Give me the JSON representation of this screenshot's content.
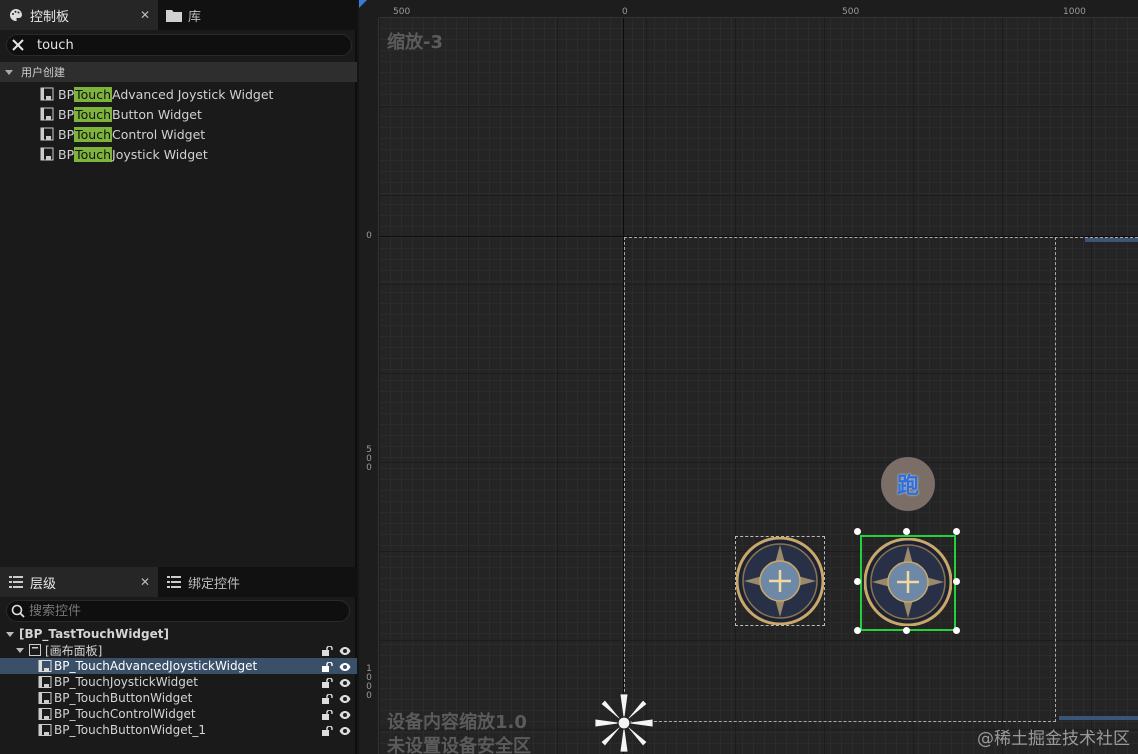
{
  "palette_panel": {
    "tab_palette": "控制板",
    "tab_library": "库",
    "close_glyph": "✕",
    "search_value": "touch",
    "category": "用户创建",
    "items": [
      {
        "prefix": "BP",
        "match": "Touch",
        "suffix": " Advanced Joystick Widget"
      },
      {
        "prefix": "BP",
        "match": "Touch",
        "suffix": " Button Widget"
      },
      {
        "prefix": "BP",
        "match": "Touch",
        "suffix": " Control Widget"
      },
      {
        "prefix": "BP",
        "match": "Touch",
        "suffix": " Joystick Widget"
      }
    ]
  },
  "hierarchy_panel": {
    "tab_hierarchy": "层级",
    "tab_bind": "绑定控件",
    "close_glyph": "✕",
    "search_placeholder": "搜索控件",
    "root": "[BP_TastTouchWidget]",
    "canvas": "[画布面板]",
    "children": [
      {
        "label": "BP_TouchAdvancedJoystickWidget",
        "selected": true
      },
      {
        "label": "BP_TouchJoystickWidget",
        "selected": false
      },
      {
        "label": "BP_TouchButtonWidget",
        "selected": false
      },
      {
        "label": "BP_TouchControlWidget",
        "selected": false
      },
      {
        "label": "BP_TouchButtonWidget_1",
        "selected": false
      }
    ]
  },
  "designer": {
    "zoom_label": "缩放-3",
    "ruler_top": [
      "500",
      "0",
      "500",
      "1000"
    ],
    "ruler_left_0": "0",
    "ruler_left_500": "5\n0\n0",
    "ruler_left_1000": "1\n0\n0\n0",
    "device_scale": "设备内容缩放1.0",
    "safe_zone": "未设置设备安全区",
    "run_button_glyph": "跑",
    "watermark": "@稀土掘金技术社区"
  },
  "colors": {
    "selection": "#23d13a",
    "highlight": "#7fb43c",
    "selected_row": "#3a4f68",
    "run_text": "#2c6ee0"
  }
}
